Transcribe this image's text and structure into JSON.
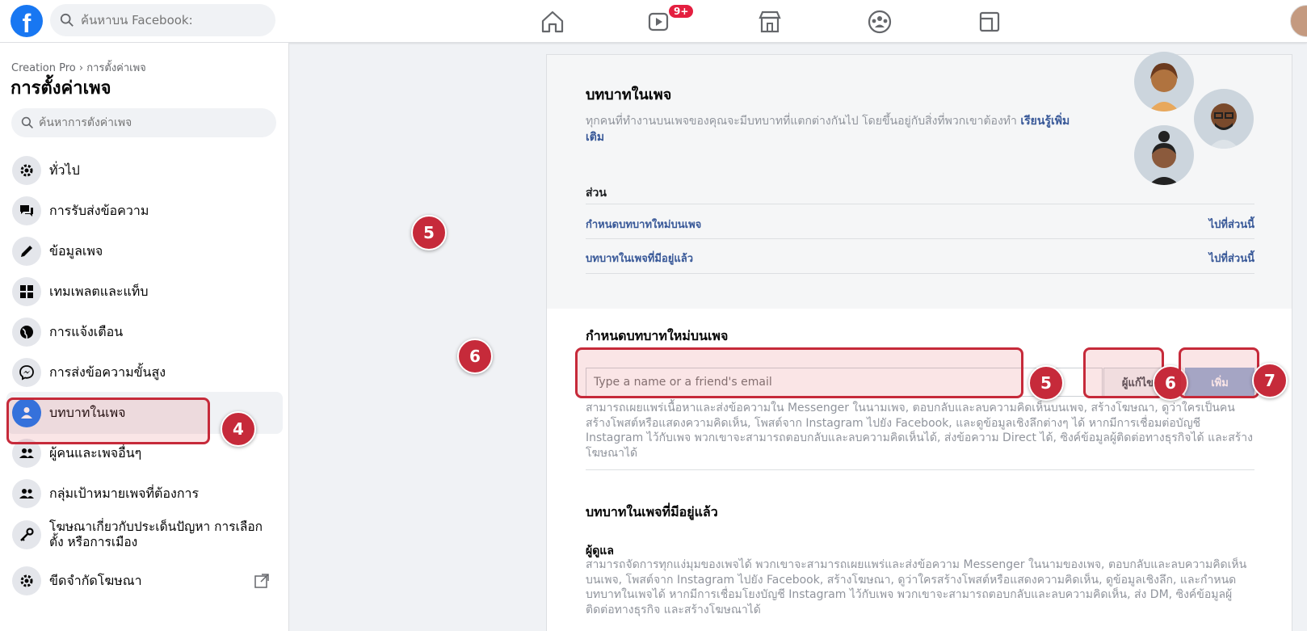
{
  "topbar": {
    "logo_letter": "f",
    "search_placeholder": "ค้นหาบน Facebook:",
    "video_badge": "9+",
    "nav_icons": [
      "home-icon",
      "watch-icon",
      "marketplace-icon",
      "groups-icon",
      "gaming-icon"
    ]
  },
  "sidebar": {
    "breadcrumb": "Creation Pro › การตั้งค่าเพจ",
    "title": "การตั้งค่าเพจ",
    "search_placeholder": "ค้นหาการตั้งค่าเพจ",
    "items": [
      {
        "label": "ทั่วไป",
        "icon": "gear-icon"
      },
      {
        "label": "การรับส่งข้อความ",
        "icon": "chat-icon"
      },
      {
        "label": "ข้อมูลเพจ",
        "icon": "pencil-icon"
      },
      {
        "label": "เทมเพลตและแท็บ",
        "icon": "grid-icon"
      },
      {
        "label": "การแจ้งเตือน",
        "icon": "globe-icon"
      },
      {
        "label": "การส่งข้อความขั้นสูง",
        "icon": "messenger-icon"
      },
      {
        "label": "บทบาทในเพจ",
        "icon": "person-icon"
      },
      {
        "label": "ผู้คนและเพจอื่นๆ",
        "icon": "people-icon"
      },
      {
        "label": "กลุ่มเป้าหมายเพจที่ต้องการ",
        "icon": "people-icon"
      },
      {
        "label": "โฆษณาเกี่ยวกับประเด็นปัญหา การเลือกตั้ง หรือการเมือง",
        "icon": "key-icon"
      },
      {
        "label": "ขีดจำกัดโฆษณา",
        "icon": "gear-icon"
      }
    ]
  },
  "roles": {
    "title": "บทบาทในเพจ",
    "desc": "ทุกคนที่ทำงานบนเพจของคุณจะมีบทบาทที่แตกต่างกันไป โดยขึ้นอยู่กับสิ่งที่พวกเขาต้องทำ",
    "learn_more": "เรียนรู้เพิ่มเติม",
    "section_label": "ส่วน",
    "rows": [
      {
        "label": "กำหนดบทบาทใหม่บนเพจ",
        "go": "ไปที่ส่วนนี้"
      },
      {
        "label": "บทบาทในเพจที่มีอยู่แล้ว",
        "go": "ไปที่ส่วนนี้"
      }
    ]
  },
  "assign": {
    "title": "กำหนดบทบาทใหม่บนเพจ",
    "email_placeholder": "Type a name or a friend's email",
    "role_value": "ผู้แก้ไข",
    "add_label": "เพิ่ม",
    "desc": "สามารถเผยแพร่เนื้อหาและส่งข้อความใน Messenger ในนามเพจ, ตอบกลับและลบความคิดเห็นบนเพจ, สร้างโฆษณา, ดูว่าใครเป็นคนสร้างโพสต์หรือแสดงความคิดเห็น, โพสต์จาก Instagram ไปยัง Facebook, และดูข้อมูลเชิงลึกต่างๆ ได้ หากมีการเชื่อมต่อบัญชี Instagram ไว้กับเพจ พวกเขาจะสามารถตอบกลับและลบความคิดเห็นได้, ส่งข้อความ Direct ได้, ซิงค์ข้อมูลผู้ติดต่อทางธุรกิจได้ และสร้างโฆษณาได้"
  },
  "existing": {
    "title": "บทบาทในเพจที่มีอยู่แล้ว",
    "admin_label": "ผู้ดูแล",
    "admin_desc": "สามารถจัดการทุกแง่มุมของเพจได้ พวกเขาจะสามารถเผยแพร่และส่งข้อความ Messenger ในนามของเพจ, ตอบกลับและลบความคิดเห็นบนเพจ, โพสต์จาก Instagram ไปยัง Facebook, สร้างโฆษณา, ดูว่าใครสร้างโพสต์หรือแสดงความคิดเห็น, ดูข้อมูลเชิงลึก, และกำหนดบทบาทในเพจได้ หากมีการเชื่อมโยงบัญชี Instagram ไว้กับเพจ พวกเขาจะสามารถตอบกลับและลบความคิดเห็น, ส่ง DM, ซิงค์ข้อมูลผู้ติดต่อทางธุรกิจ และสร้างโฆษณาได้"
  },
  "annotations": [
    "4",
    "5",
    "6",
    "5",
    "6",
    "7"
  ],
  "colors": {
    "brand": "#1877f2",
    "annotation": "#c62a3a",
    "link": "#385898"
  }
}
